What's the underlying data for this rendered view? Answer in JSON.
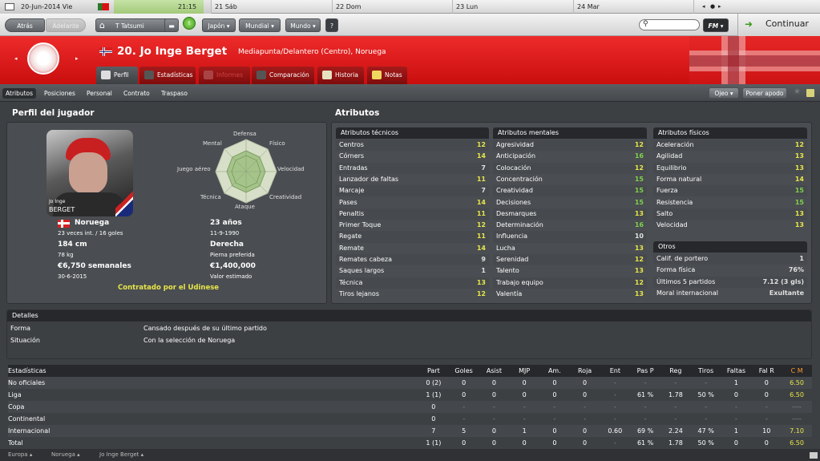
{
  "calendar": {
    "date": "20-Jun-2014 Vie",
    "time": "21:15",
    "days": [
      "21 Sáb",
      "22 Dom",
      "23 Lun",
      "24 Mar"
    ]
  },
  "nav": {
    "back": "Atrás",
    "forward": "Adelante",
    "manager": "T Tatsumi",
    "league": "Japón",
    "mundial": "Mundial",
    "mundo": "Mundo",
    "help": "?",
    "fm": "FM",
    "continue": "Continuar"
  },
  "player": {
    "title": "20. Jo Inge Berget",
    "position": "Mediapunta/Delantero (Centro), Noruega"
  },
  "tabs": [
    "Perfil",
    "Estadísticas",
    "Informes",
    "Comparación",
    "Historia",
    "Notas"
  ],
  "subnav": [
    "Atributos",
    "Posiciones",
    "Personal",
    "Contrato",
    "Traspaso"
  ],
  "subnav_right": {
    "ojeo": "Ojeo",
    "apodo": "Poner apodo"
  },
  "profile": {
    "title": "Perfil del jugador",
    "photo_name": "Jo Inge",
    "photo_surname": "BERGET",
    "radar_labels": [
      "Defensa",
      "Físico",
      "Velocidad",
      "Creatividad",
      "Ataque",
      "Técnica",
      "Juego aéreo",
      "Mental"
    ],
    "nation": "Noruega",
    "caps": "23 veces int. / 16 goles",
    "age": "23 años",
    "dob": "11-9-1990",
    "height": "184 cm",
    "weight": "78 kg",
    "foot": "Derecha",
    "foot_label": "Pierna preferida",
    "wage": "€6,750 semanales",
    "contract_end": "30-6-2015",
    "value": "€1,400,000",
    "value_label": "Valor estimado",
    "status": "Contratado por el Udinese"
  },
  "attributes": {
    "title": "Atributos",
    "technical_title": "Atributos técnicos",
    "technical": [
      [
        "Centros",
        "12"
      ],
      [
        "Córners",
        "14"
      ],
      [
        "Entradas",
        "7"
      ],
      [
        "Lanzador de faltas",
        "11"
      ],
      [
        "Marcaje",
        "7"
      ],
      [
        "Pases",
        "14"
      ],
      [
        "Penaltis",
        "11"
      ],
      [
        "Primer Toque",
        "12"
      ],
      [
        "Regate",
        "11"
      ],
      [
        "Remate",
        "14"
      ],
      [
        "Remates cabeza",
        "9"
      ],
      [
        "Saques largos",
        "1"
      ],
      [
        "Técnica",
        "13"
      ],
      [
        "Tiros lejanos",
        "12"
      ]
    ],
    "mental_title": "Atributos mentales",
    "mental": [
      [
        "Agresividad",
        "12"
      ],
      [
        "Anticipación",
        "16"
      ],
      [
        "Colocación",
        "12"
      ],
      [
        "Concentración",
        "15"
      ],
      [
        "Creatividad",
        "15"
      ],
      [
        "Decisiones",
        "15"
      ],
      [
        "Desmarques",
        "13"
      ],
      [
        "Determinación",
        "16"
      ],
      [
        "Influencia",
        "10"
      ],
      [
        "Lucha",
        "13"
      ],
      [
        "Serenidad",
        "12"
      ],
      [
        "Talento",
        "13"
      ],
      [
        "Trabajo equipo",
        "12"
      ],
      [
        "Valentía",
        "13"
      ]
    ],
    "physical_title": "Atributos físicos",
    "physical": [
      [
        "Aceleración",
        "12"
      ],
      [
        "Agilidad",
        "13"
      ],
      [
        "Equilibrio",
        "13"
      ],
      [
        "Forma natural",
        "14"
      ],
      [
        "Fuerza",
        "15"
      ],
      [
        "Resistencia",
        "15"
      ],
      [
        "Salto",
        "13"
      ],
      [
        "Velocidad",
        "13"
      ]
    ],
    "other_title": "Otros",
    "other": [
      [
        "Calif. de portero",
        "1"
      ],
      [
        "Forma física",
        "76%"
      ],
      [
        "Últimos 5 partidos",
        "7.12 (3 gls)"
      ],
      [
        "Moral internacional",
        "Exultante"
      ]
    ]
  },
  "details": {
    "title": "Detalles",
    "rows": [
      [
        "Forma",
        "Cansado después de su último partido"
      ],
      [
        "Situación",
        "Con la selección de Noruega"
      ]
    ]
  },
  "stats": {
    "headers": [
      "Estadísticas",
      "Part",
      "Goles",
      "Asist",
      "MJP",
      "Am.",
      "Roja",
      "Ent",
      "Pas P",
      "Reg",
      "Tiros",
      "Faltas",
      "Fal R",
      "C M"
    ],
    "rows": [
      [
        "No oficiales",
        "0 (2)",
        "0",
        "0",
        "0",
        "0",
        "0",
        "-",
        "-",
        "-",
        "-",
        "1",
        "0",
        "6.50"
      ],
      [
        "Liga",
        "1 (1)",
        "0",
        "0",
        "0",
        "0",
        "0",
        "-",
        "61 %",
        "1.78",
        "50 %",
        "0",
        "0",
        "6.50"
      ],
      [
        "Copa",
        "0",
        "-",
        "-",
        "-",
        "-",
        "-",
        "-",
        "-",
        "-",
        "-",
        "-",
        "-",
        "----"
      ],
      [
        "Continental",
        "0",
        "-",
        "-",
        "-",
        "-",
        "-",
        "-",
        "-",
        "-",
        "-",
        "-",
        "-",
        "----"
      ],
      [
        "Internacional",
        "7",
        "5",
        "0",
        "1",
        "0",
        "0",
        "0.60",
        "69 %",
        "2.24",
        "47 %",
        "1",
        "10",
        "7.10"
      ],
      [
        "Total",
        "1 (1)",
        "0",
        "0",
        "0",
        "0",
        "0",
        "-",
        "61 %",
        "1.78",
        "50 %",
        "0",
        "0",
        "6.50"
      ]
    ]
  },
  "footer": [
    "Europa",
    "Noruega",
    "Jo Inge Berget"
  ]
}
